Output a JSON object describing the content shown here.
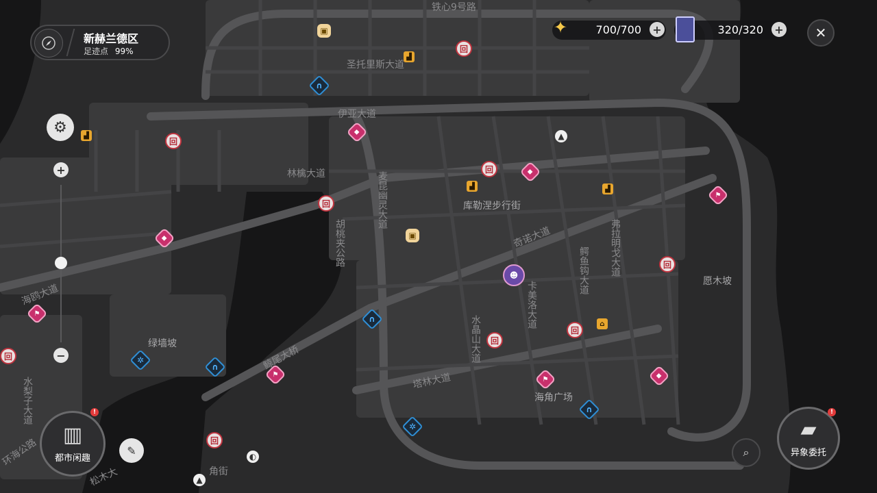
{
  "region": {
    "name": "新赫兰德区",
    "footprint_label": "足迹点",
    "footprint_value": "99%"
  },
  "resources": [
    {
      "value": "700/700",
      "icon": "energy-icon"
    },
    {
      "value": "320/320",
      "icon": "card-icon"
    }
  ],
  "streets": [
    "铁心9号路",
    "圣托里斯大道",
    "伊亚大道",
    "林檎大道",
    "麦昆幽灵大道",
    "胡桃夹公路",
    "库勒涅步行街",
    "奇诺大道",
    "弗拉明戈大道",
    "鳄鱼钩大道",
    "卡美洛大道",
    "水晶山大道",
    "塔林大道",
    "海角广场",
    "愿木坡",
    "绿墙坡",
    "鲸尾大桥",
    "海鸥大道",
    "水梨子大道",
    "环海公路",
    "角街",
    "松木大"
  ],
  "buttons": {
    "city_fun": "都市闲趣",
    "commission": "异象委托"
  },
  "colors": {
    "accent_red": "#c0343f",
    "accent_blue": "#2f8fd6",
    "accent_pink": "#c8306c",
    "badge": "#e23b3b"
  }
}
